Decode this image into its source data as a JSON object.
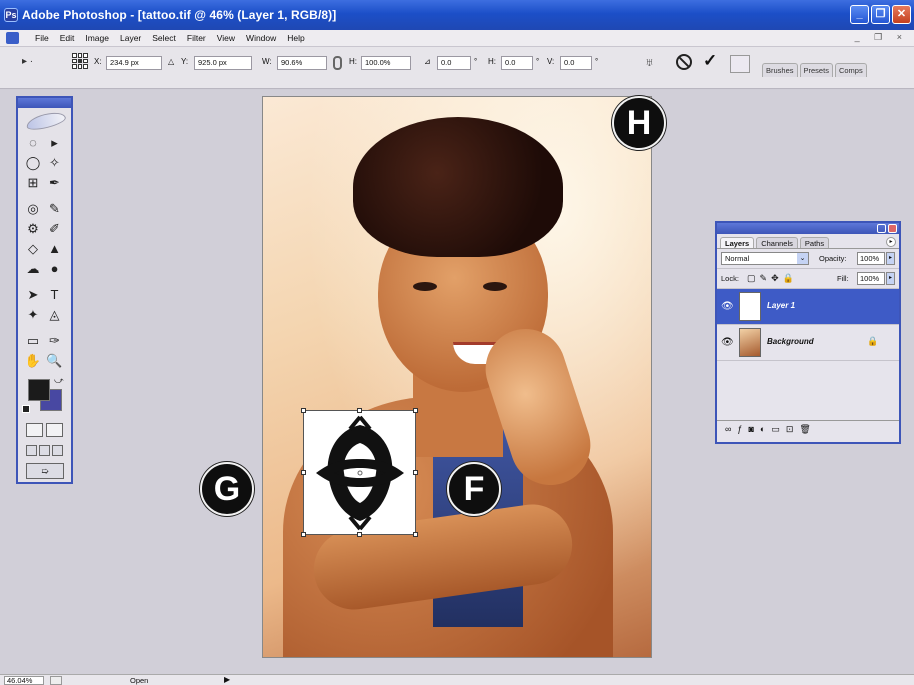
{
  "window": {
    "title": "Adobe Photoshop - [tattoo.tif @ 46% (Layer 1, RGB/8)]",
    "buttons": {
      "minimize": "_",
      "restore": "❐",
      "close": "✕"
    },
    "doc_controls": "_ ❐ ×"
  },
  "menu": [
    "File",
    "Edit",
    "Image",
    "Layer",
    "Select",
    "Filter",
    "View",
    "Window",
    "Help"
  ],
  "options_bar": {
    "x_label": "X:",
    "x_value": "234.9 px",
    "y_label": "Y:",
    "y_value": "925.0 px",
    "w_label": "W:",
    "w_value": "90.6%",
    "h_label": "H:",
    "h_value": "100.0%",
    "angle_value": "0.0",
    "angle_unit": "°",
    "hskew_label": "H:",
    "hskew_value": "0.0",
    "hskew_unit": "°",
    "vskew_label": "V:",
    "vskew_value": "0.0",
    "vskew_unit": "°",
    "palette_tabs": [
      "Brushes",
      "Presets",
      "Comps"
    ]
  },
  "toolbox": {
    "tools": [
      "◌",
      "▸",
      "◯",
      "✧",
      "⊞",
      "✒",
      "◎",
      "✎",
      "⚙",
      "✐",
      "◇",
      "▲",
      "☁",
      "●",
      "➤",
      "T",
      "✦",
      "◬",
      "▭",
      "✑",
      "✋",
      "🔍"
    ],
    "fg_color": "#1b1b1b",
    "bg_color": "#4848a2"
  },
  "callouts": {
    "f": "F",
    "g": "G",
    "h": "H"
  },
  "layers_panel": {
    "tabs": [
      "Layers",
      "Channels",
      "Paths"
    ],
    "blend_mode": "Normal",
    "opacity_label": "Opacity:",
    "opacity_value": "100%",
    "lock_label": "Lock:",
    "fill_label": "Fill:",
    "fill_value": "100%",
    "layers": [
      {
        "name": "Layer 1",
        "selected": true
      },
      {
        "name": "Background",
        "selected": false
      }
    ]
  },
  "status": {
    "zoom": "46.04%",
    "text": "Open"
  },
  "colors": {
    "title_bar": "#1f4fc8",
    "selection": "#3e5bc6"
  }
}
